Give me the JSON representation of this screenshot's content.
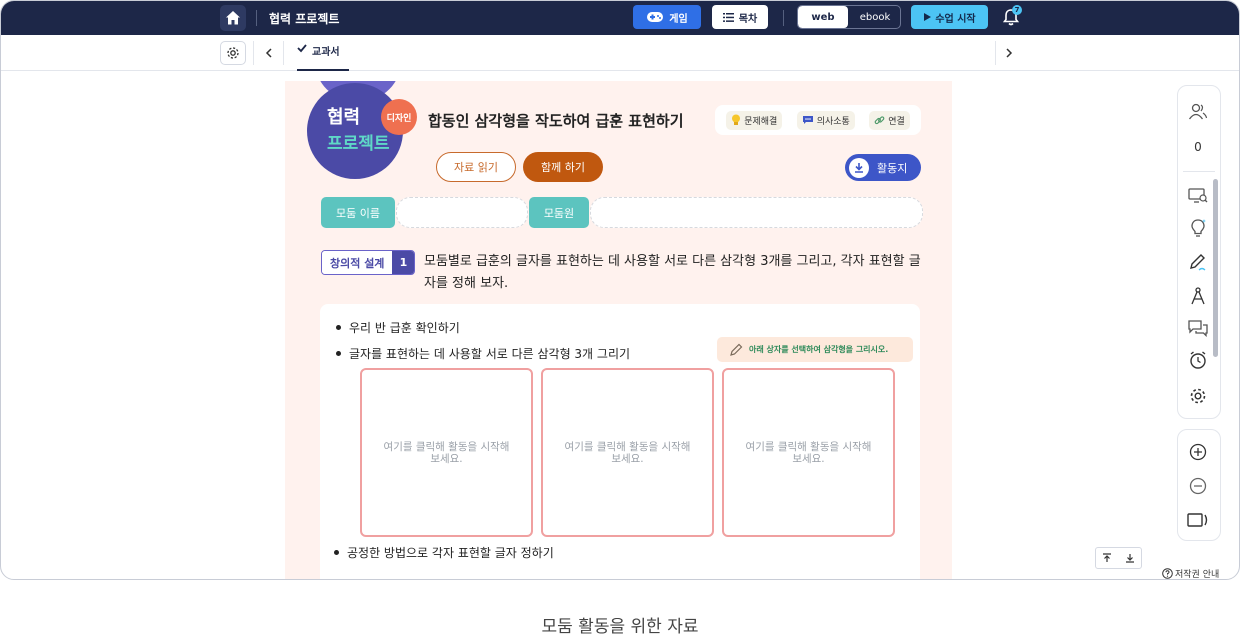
{
  "topbar": {
    "title": "협력 프로젝트",
    "game_label": "게임",
    "toc_label": "목차",
    "view_web": "web",
    "view_ebook": "ebook",
    "start_label": "수업 시작",
    "notification_count": "7"
  },
  "tabs": {
    "active_label": "교과서"
  },
  "lesson": {
    "badge_line1": "협력",
    "badge_line2": "프로젝트",
    "design_tag": "디자인",
    "title": "합동인 삼각형을 작도하여 급훈 표현하기",
    "skills": [
      {
        "label": "문제해결",
        "icon": "lightbulb-icon"
      },
      {
        "label": "의사소통",
        "icon": "chat-icon"
      },
      {
        "label": "연결",
        "icon": "link-icon"
      }
    ],
    "read_button": "자료 읽기",
    "together_button": "함께 하기",
    "worksheet_button": "활동지",
    "group_name_label": "모둠 이름",
    "group_member_label": "모둠원",
    "task_tag": "창의적 설계",
    "task_number": "1",
    "task_text": "모둠별로 급훈의 글자를 표현하는 데 사용할 서로 다른 삼각형 3개를 그리고, 각자 표현할 글자를 정해 보자.",
    "bullets": [
      "우리 반 급훈 확인하기",
      "글자를 표현하는 데 사용할 서로 다른 삼각형 3개 그리기",
      "공정한 방법으로 각자 표현할 글자 정하기"
    ],
    "hint": "아래 상자를 선택하여 삼각형을 그리시오.",
    "draw_box_text": "여기를 클릭해 활동을 시작해 보세요."
  },
  "sidebar": {
    "participant_count": "0"
  },
  "footer": {
    "copyright": "저작권 안내",
    "caption": "모둠 활동을 위한 자료"
  },
  "colors": {
    "topbar": "#1d2748",
    "accent_blue": "#2f6fe6",
    "start": "#4cc4f4",
    "content_bg": "#fff2ee",
    "purple": "#4b4aa6",
    "teal": "#5cc4bf",
    "orange": "#c0580f"
  }
}
